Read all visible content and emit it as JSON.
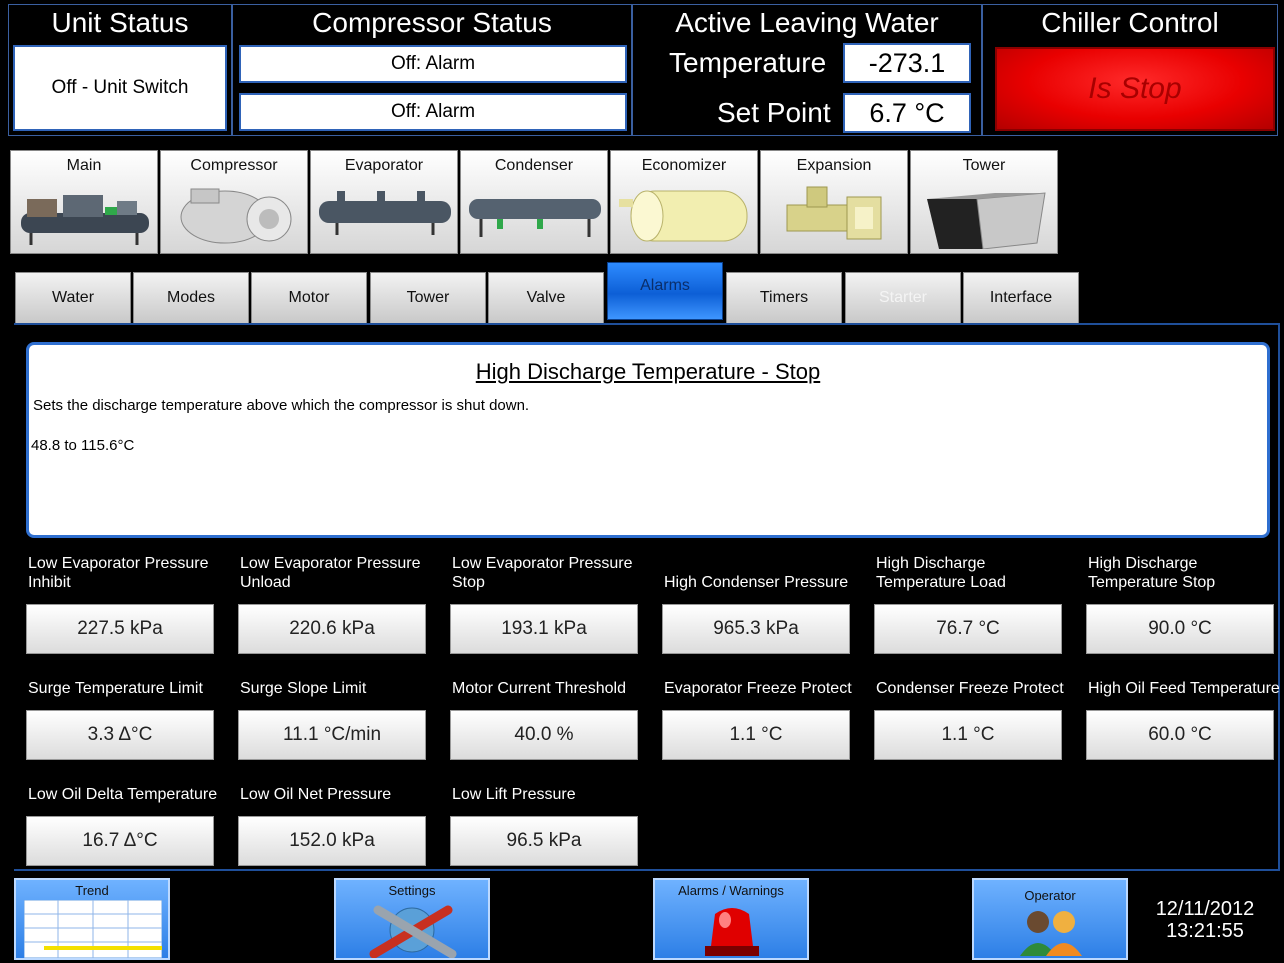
{
  "header": {
    "unit_status": {
      "title": "Unit Status",
      "value": "Off - Unit Switch"
    },
    "compressor_status": {
      "title": "Compressor Status",
      "value_1": "Off: Alarm",
      "value_2": "Off: Alarm"
    },
    "leaving_water": {
      "title": "Active Leaving Water",
      "temp_label": "Temperature",
      "temp_value": "-273.1",
      "setpoint_label": "Set Point",
      "setpoint_value": "6.7 °C"
    },
    "chiller_control": {
      "title": "Chiller Control",
      "button_label": "Is Stop"
    }
  },
  "components": [
    {
      "label": "Main",
      "icon": "chiller-assembly-icon"
    },
    {
      "label": "Compressor",
      "icon": "compressor-icon"
    },
    {
      "label": "Evaporator",
      "icon": "evaporator-icon"
    },
    {
      "label": "Condenser",
      "icon": "condenser-icon"
    },
    {
      "label": "Economizer",
      "icon": "economizer-icon"
    },
    {
      "label": "Expansion",
      "icon": "expansion-valve-icon"
    },
    {
      "label": "Tower",
      "icon": "cooling-tower-icon"
    }
  ],
  "tabs": [
    {
      "label": "Water"
    },
    {
      "label": "Modes"
    },
    {
      "label": "Motor"
    },
    {
      "label": "Tower"
    },
    {
      "label": "Valve"
    },
    {
      "label": "Alarms",
      "active": true
    },
    {
      "label": "Timers"
    },
    {
      "label": "Starter",
      "disabled": true
    },
    {
      "label": "Interface"
    }
  ],
  "info": {
    "title": "High Discharge Temperature - Stop",
    "description": "Sets the discharge temperature above which the compressor is shut down.",
    "range": "48.8 to 115.6°C"
  },
  "params": [
    {
      "label": "Low Evaporator Pressure Inhibit",
      "value": "227.5 kPa"
    },
    {
      "label": "Low Evaporator Pressure Unload",
      "value": "220.6 kPa"
    },
    {
      "label": "Low Evaporator Pressure Stop",
      "value": "193.1 kPa"
    },
    {
      "label": "High Condenser Pressure",
      "value": "965.3 kPa"
    },
    {
      "label": "High Discharge Temperature Load",
      "value": "76.7 °C"
    },
    {
      "label": "High Discharge Temperature Stop",
      "value": "90.0 °C"
    },
    {
      "label": "Surge Temperature Limit",
      "value": "3.3 Δ°C"
    },
    {
      "label": "Surge Slope Limit",
      "value": "11.1 °C/min"
    },
    {
      "label": "Motor Current Threshold",
      "value": "40.0 %"
    },
    {
      "label": "Evaporator Freeze Protect",
      "value": "1.1 °C"
    },
    {
      "label": "Condenser Freeze Protect",
      "value": "1.1 °C"
    },
    {
      "label": "High Oil Feed Temperature",
      "value": "60.0 °C"
    },
    {
      "label": "Low Oil Delta Temperature",
      "value": "16.7 Δ°C"
    },
    {
      "label": "Low Oil Net Pressure",
      "value": "152.0 kPa"
    },
    {
      "label": "Low Lift Pressure",
      "value": "96.5 kPa"
    }
  ],
  "footer": {
    "trend": "Trend",
    "settings": "Settings",
    "alarms": "Alarms / Warnings",
    "operator": "Operator",
    "date": "12/11/2012",
    "time": "13:21:55"
  },
  "colors": {
    "background": "#000000",
    "panel_border": "#2f63b8",
    "active_tab": "#1f7bf0",
    "stop_button": "#e90000"
  }
}
